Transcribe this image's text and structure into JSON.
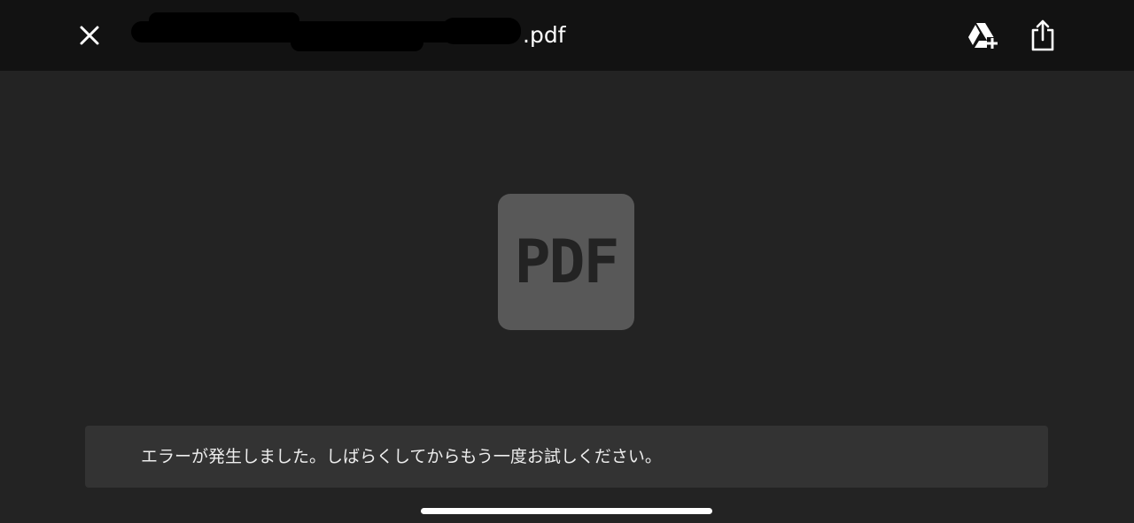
{
  "header": {
    "file_name": ".pdf",
    "close_icon": "close-icon",
    "drive_icon": "google-drive-add-icon",
    "share_icon": "share-icon"
  },
  "viewer": {
    "file_icon_label": "PDF",
    "file_icon_color": "#585858"
  },
  "toast": {
    "message": "エラーが発生しました。しばらくしてからもう一度お試しください。"
  },
  "colors": {
    "header_bg": "#121212",
    "page_bg": "#232323",
    "toast_bg": "#333333"
  }
}
